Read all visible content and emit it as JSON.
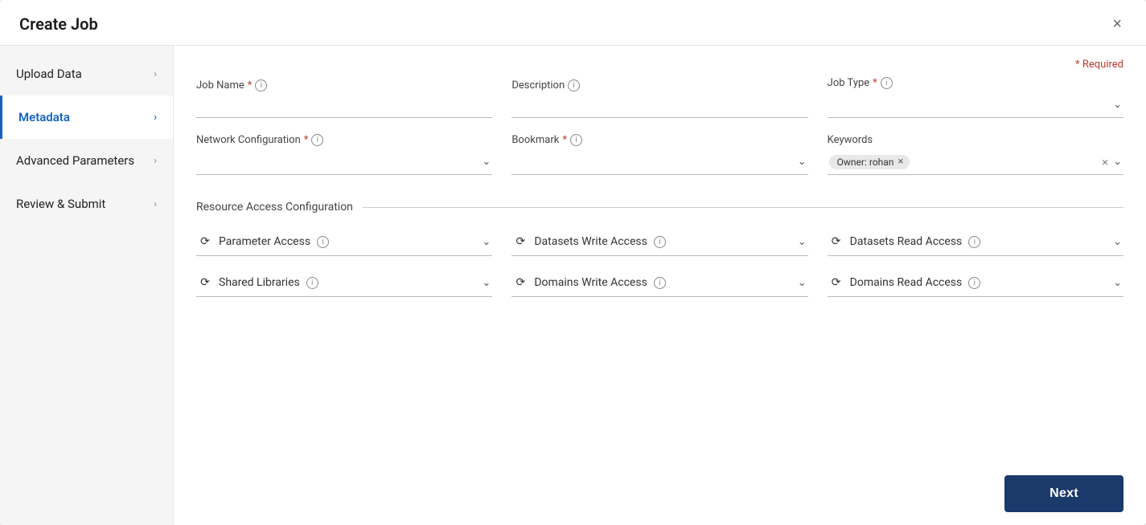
{
  "modal": {
    "title": "Create Job",
    "close_label": "×"
  },
  "sidebar": {
    "items": [
      {
        "id": "upload-data",
        "label": "Upload Data",
        "active": false
      },
      {
        "id": "metadata",
        "label": "Metadata",
        "active": true
      },
      {
        "id": "advanced-parameters",
        "label": "Advanced Parameters",
        "active": false
      },
      {
        "id": "review-submit",
        "label": "Review & Submit",
        "active": false
      }
    ]
  },
  "required_note": "* Required",
  "form": {
    "job_name": {
      "label": "Job Name",
      "required": true,
      "placeholder": "",
      "value": ""
    },
    "description": {
      "label": "Description",
      "required": false,
      "placeholder": "",
      "value": ""
    },
    "job_type": {
      "label": "Job Type",
      "required": true,
      "value": ""
    },
    "network_configuration": {
      "label": "Network Configuration",
      "required": true,
      "value": ""
    },
    "bookmark": {
      "label": "Bookmark",
      "required": true,
      "value": ""
    },
    "keywords": {
      "label": "Keywords",
      "tags": [
        "Owner: rohan"
      ]
    }
  },
  "resource_access": {
    "section_label": "Resource Access Configuration",
    "fields": [
      {
        "id": "parameter-access",
        "label": "Parameter Access"
      },
      {
        "id": "datasets-write-access",
        "label": "Datasets Write Access"
      },
      {
        "id": "datasets-read-access",
        "label": "Datasets Read Access"
      },
      {
        "id": "shared-libraries",
        "label": "Shared Libraries"
      },
      {
        "id": "domains-write-access",
        "label": "Domains Write Access"
      },
      {
        "id": "domains-read-access",
        "label": "Domains Read Access"
      }
    ]
  },
  "footer": {
    "next_label": "Next"
  },
  "icons": {
    "info": "i",
    "chevron_down": "⌄",
    "chevron_right": "›",
    "close": "×",
    "tag_remove": "×",
    "sync": "⟳"
  }
}
